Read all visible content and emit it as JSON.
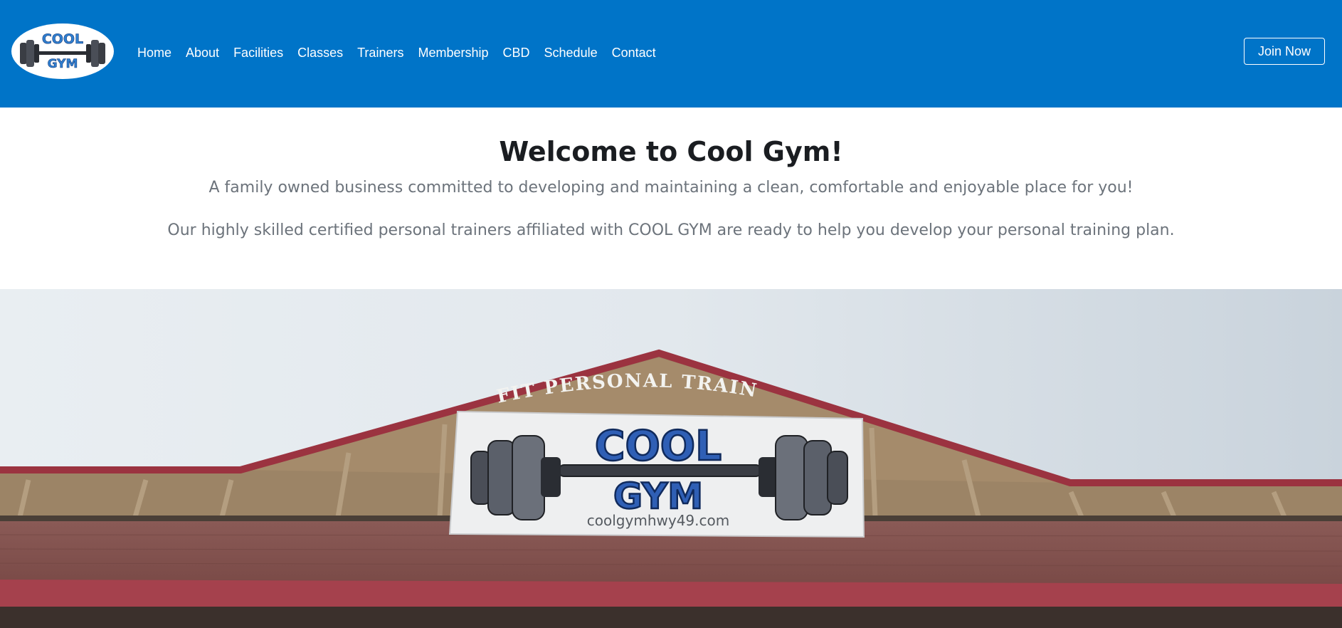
{
  "header": {
    "logo": {
      "text_top": "COOL",
      "text_bottom": "GYM"
    },
    "nav": [
      {
        "label": "Home"
      },
      {
        "label": "About"
      },
      {
        "label": "Facilities"
      },
      {
        "label": "Classes"
      },
      {
        "label": "Trainers"
      },
      {
        "label": "Membership"
      },
      {
        "label": "CBD"
      },
      {
        "label": "Schedule"
      },
      {
        "label": "Contact"
      }
    ],
    "cta_label": "Join Now"
  },
  "welcome": {
    "title": "Welcome to Cool Gym!",
    "line1": "A family owned business committed to developing and maintaining a clean, comfortable and enjoyable place for you!",
    "line2": "Our highly skilled certified personal trainers affiliated with COOL GYM are ready to help you develop your personal training plan."
  },
  "hero": {
    "banner_top": "COOL",
    "banner_bottom": "GYM",
    "banner_url": "coolgymhwy49.com",
    "arch_text": "FIT PERSONAL TRAIN"
  },
  "colors": {
    "nav_bg": "#0074c8",
    "title": "#1a1d21",
    "body_text": "#6c737b",
    "banner_blue": "#2f5fb5",
    "roof_red": "#9b3340",
    "wall_tan": "#9c8466"
  }
}
